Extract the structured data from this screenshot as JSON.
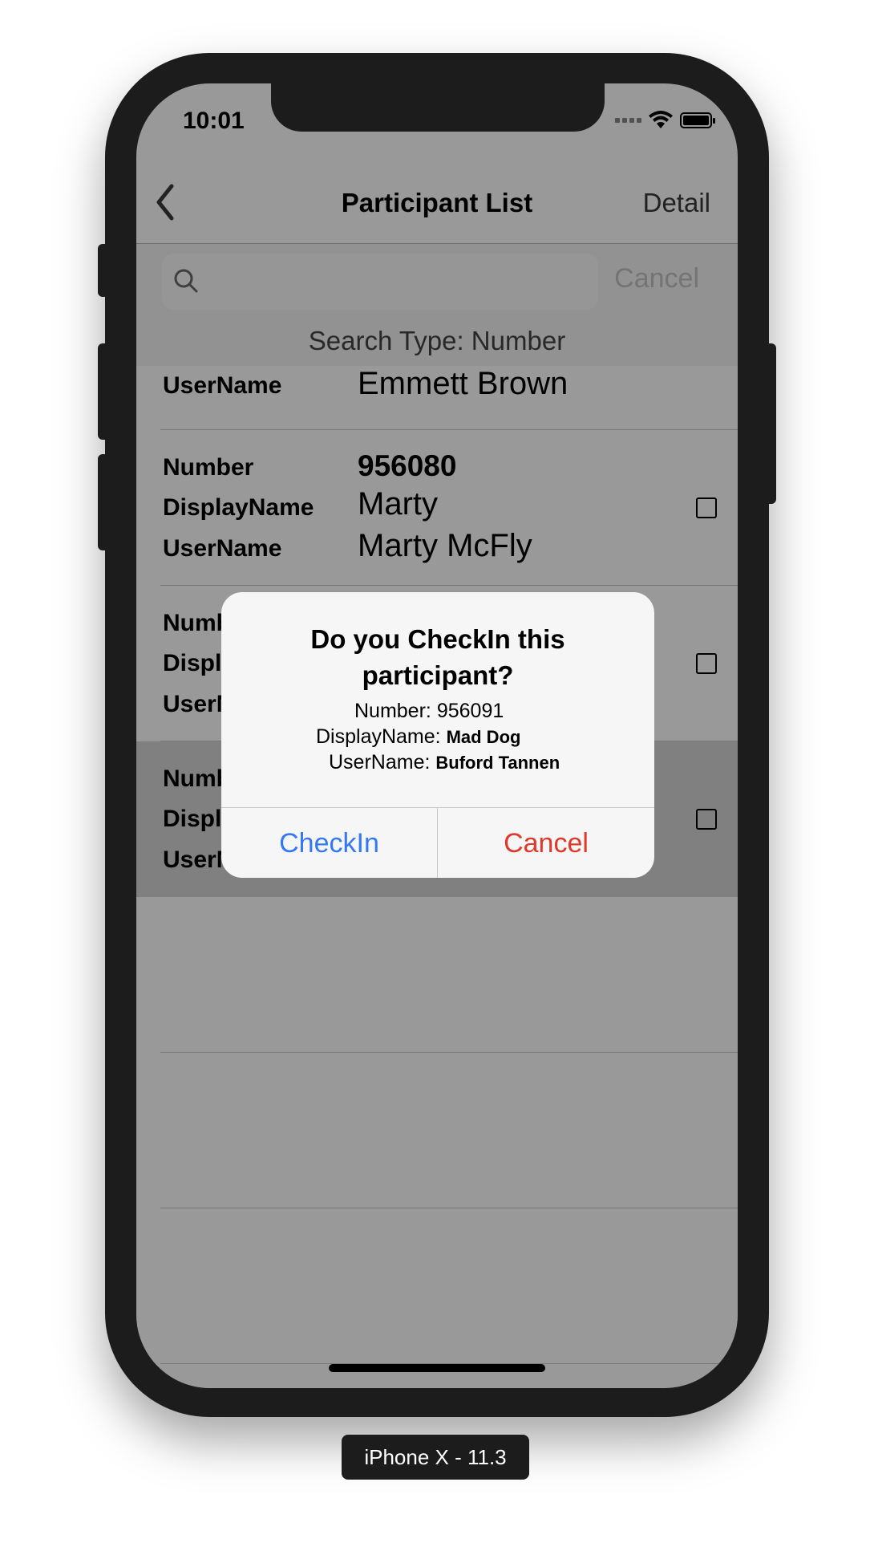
{
  "status_bar": {
    "time": "10:01"
  },
  "nav": {
    "title": "Participant List",
    "detail_label": "Detail"
  },
  "search": {
    "placeholder": "",
    "cancel_label": "Cancel",
    "type_text": "Search Type: Number"
  },
  "list": {
    "labels": {
      "number": "Number",
      "display_name": "DisplayName",
      "user_name": "UserName"
    },
    "rows": [
      {
        "user_name": "Emmett Brown"
      },
      {
        "number": "956080",
        "display_name": "Marty",
        "user_name": "Marty McFly"
      },
      {
        "number": "",
        "display_name": "",
        "user_name": ""
      },
      {
        "number": "",
        "display_name": "",
        "user_name": "",
        "highlighted": true
      }
    ]
  },
  "alert": {
    "title_line1": "Do you CheckIn this",
    "title_line2": "participant?",
    "number_label": "Number:",
    "number_value": "956091",
    "display_label": "DisplayName:",
    "display_value": "Mad Dog",
    "user_label": "UserName:",
    "user_value": "Buford Tannen",
    "checkin_label": "CheckIn",
    "cancel_label": "Cancel"
  },
  "simulator": {
    "label": "iPhone X - 11.3"
  },
  "colors": {
    "accent_blue": "#3478f6",
    "destructive_red": "#e0392b",
    "device": "#1c1c1c"
  },
  "icons": [
    "back-chevron-icon",
    "search-icon",
    "wifi-icon",
    "battery-icon",
    "signal-icon"
  ]
}
